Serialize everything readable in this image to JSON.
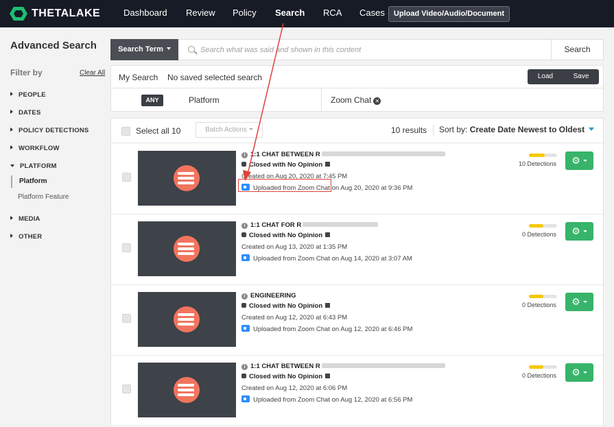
{
  "brand": {
    "name": "THETALAKE"
  },
  "nav": {
    "items": [
      "Dashboard",
      "Review",
      "Policy",
      "Search",
      "RCA",
      "Cases"
    ],
    "active": "Search",
    "upload_label": "Upload Video/Audio/Document"
  },
  "sidebar": {
    "title": "Advanced Search",
    "filter_by": "Filter by",
    "clear_all": "Clear All",
    "categories": [
      "PEOPLE",
      "DATES",
      "POLICY DETECTIONS",
      "WORKFLOW",
      "PLATFORM",
      "MEDIA",
      "OTHER"
    ],
    "platform_sub": [
      "Platform",
      "Platform Feature"
    ]
  },
  "search": {
    "type_label": "Search Term",
    "placeholder": "Search what was said and shown in this content",
    "button": "Search"
  },
  "saved_search": {
    "label": "My Search",
    "value": "No saved selected search",
    "load": "Load",
    "save": "Save"
  },
  "filter": {
    "match": "ANY",
    "field": "Platform",
    "value": "Zoom Chat"
  },
  "results_header": {
    "select_all": "Select all 10",
    "batch_actions": "Batch Actions",
    "count": "10 results",
    "sort_label": "Sort by:",
    "sort_value": "Create Date Newest to Oldest"
  },
  "results": [
    {
      "title": "1:1 CHAT BETWEEN R",
      "status": "Closed with No Opinion",
      "created": "Created on Aug 20, 2020 at 7:45 PM",
      "uploaded": "Uploaded from Zoom Chat on Aug 20, 2020 at 9:36 PM",
      "detections": "10 Detections",
      "detection_level": 0.55
    },
    {
      "title": "1:1 CHAT FOR R",
      "status": "Closed with No Opinion",
      "created": "Created on Aug 13, 2020 at 1:35 PM",
      "uploaded": "Uploaded from Zoom Chat on Aug 14, 2020 at 3:07 AM",
      "detections": "0 Detections",
      "detection_level": 0.5
    },
    {
      "title": "ENGINEERING",
      "status": "Closed with No Opinion",
      "created": "Created on Aug 12, 2020 at 6:43 PM",
      "uploaded": "Uploaded from Zoom Chat on Aug 12, 2020 at 6:46 PM",
      "detections": "0 Detections",
      "detection_level": 0.5
    },
    {
      "title": "1:1 CHAT BETWEEN R",
      "status": "Closed with No Opinion",
      "created": "Created on Aug 12, 2020 at 6:06 PM",
      "uploaded": "Uploaded from Zoom Chat on Aug 12, 2020 at 6:56 PM",
      "detections": "0 Detections",
      "detection_level": 0.5
    }
  ],
  "colors": {
    "nav_bg": "#161b26",
    "accent_green": "#37b46a",
    "accent_blue": "#2a9bd6",
    "detection_yellow": "#f5c900",
    "annotation_red": "#e0413b"
  }
}
